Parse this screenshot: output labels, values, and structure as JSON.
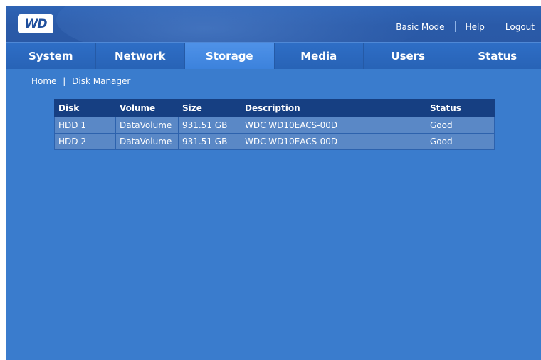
{
  "header": {
    "logo_text": "WD",
    "links": [
      "Basic Mode",
      "Help",
      "Logout"
    ]
  },
  "nav": {
    "tabs": [
      "System",
      "Network",
      "Storage",
      "Media",
      "Users",
      "Status"
    ],
    "active": "Storage"
  },
  "breadcrumb": {
    "home": "Home",
    "separator": "|",
    "current": "Disk Manager"
  },
  "table": {
    "columns": [
      "Disk",
      "Volume",
      "Size",
      "Description",
      "Status"
    ],
    "rows": [
      [
        "HDD 1",
        "DataVolume",
        "931.51 GB",
        "WDC WD10EACS-00D",
        "Good"
      ],
      [
        "HDD 2",
        "DataVolume",
        "931.51 GB",
        "WDC WD10EACS-00D",
        "Good"
      ]
    ]
  },
  "colors": {
    "background": "#3a7ccd",
    "header_bar": "#2a5aa8",
    "active_tab": "#4a8ee4",
    "table_header": "#163f82",
    "table_cell": "#5a88c6"
  }
}
